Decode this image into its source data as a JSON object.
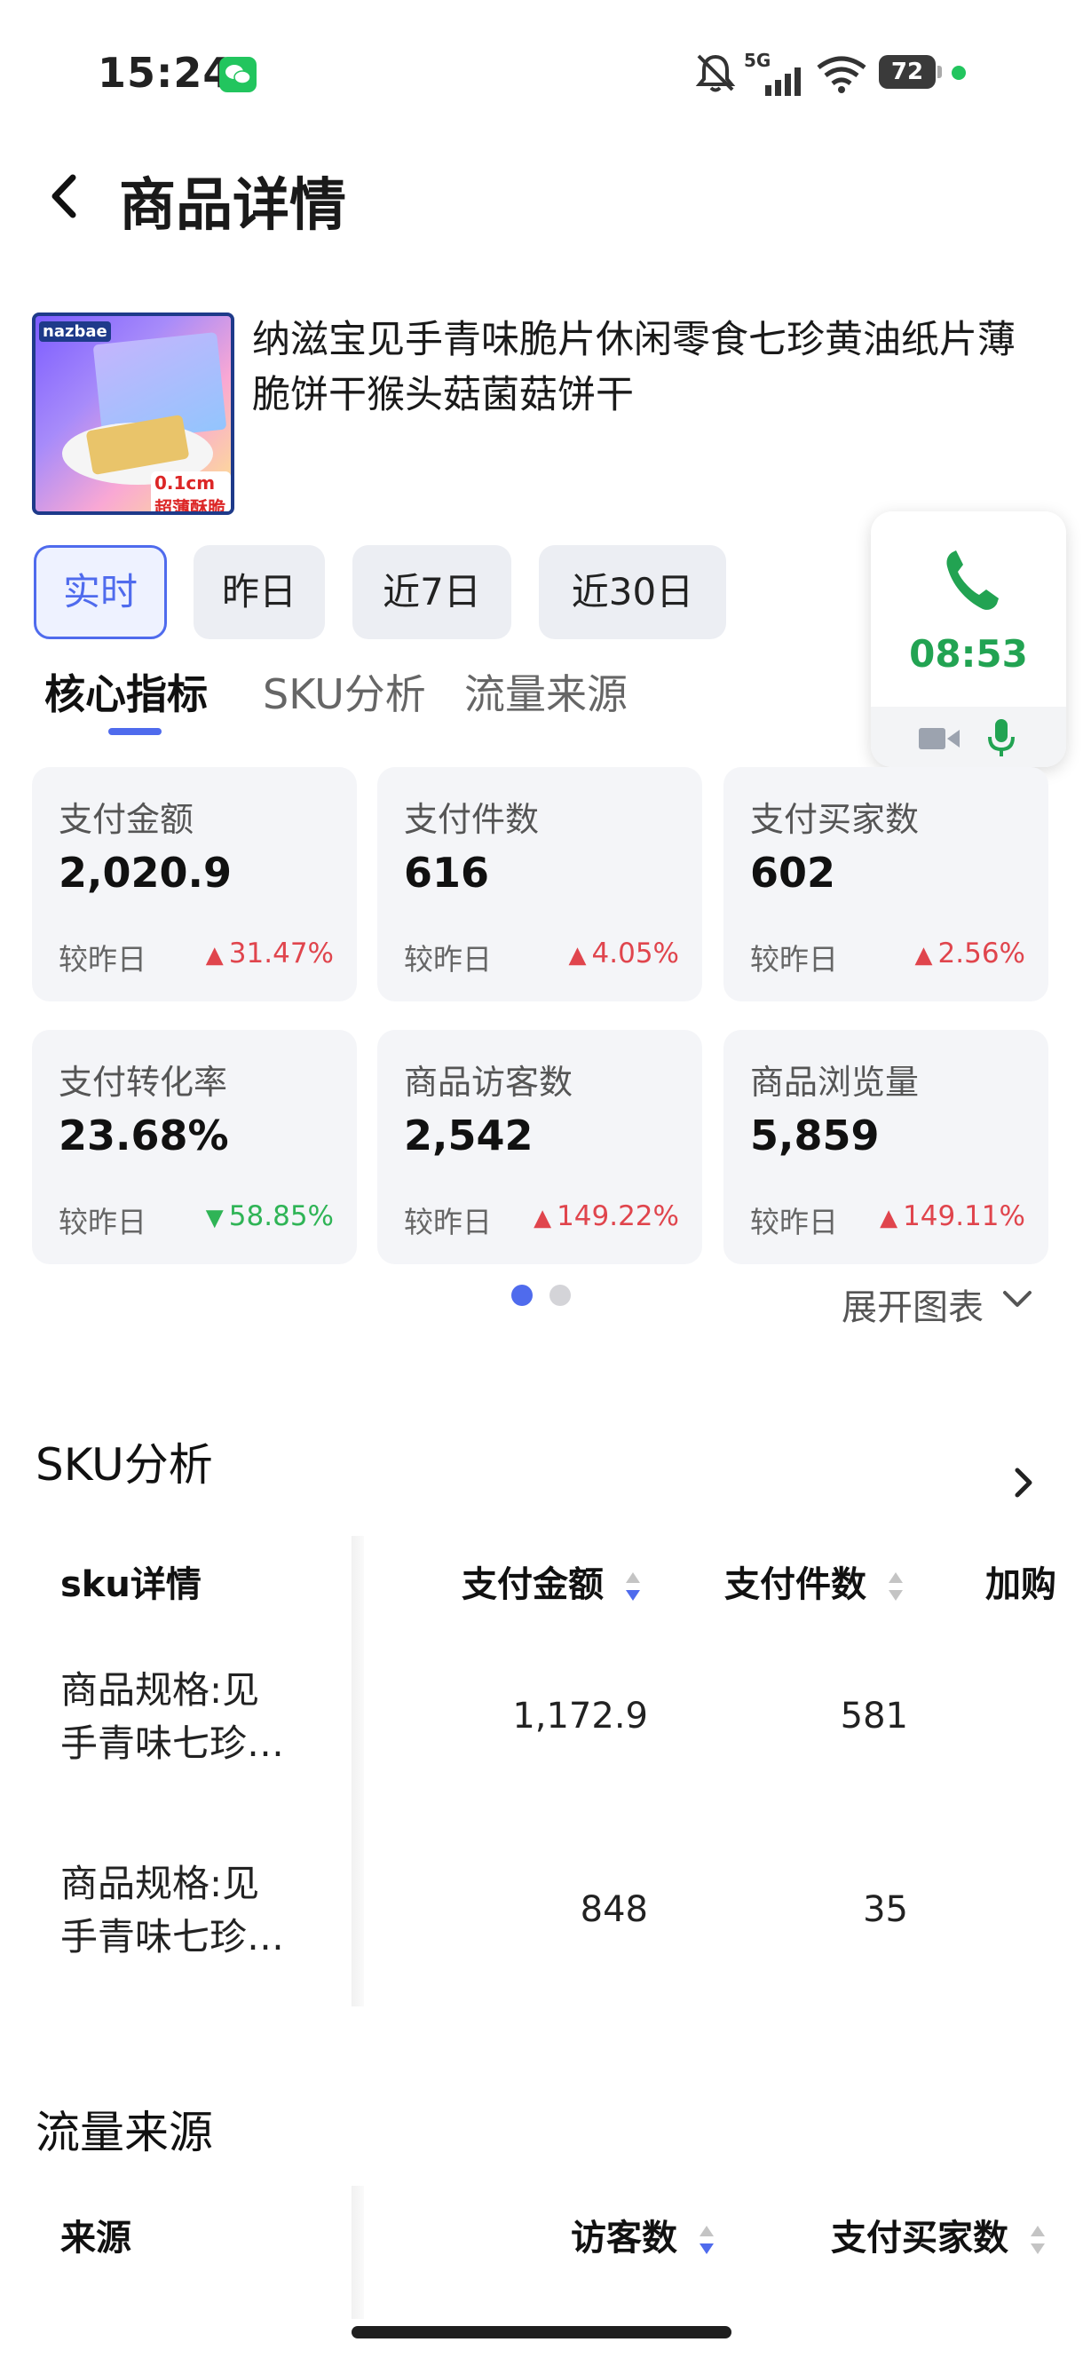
{
  "status_bar": {
    "time": "15:24",
    "network": "5G",
    "battery": "72"
  },
  "header": {
    "title": "商品详情"
  },
  "product": {
    "name": "纳滋宝见手青味脆片休闲零食七珍黄油纸片薄脆饼干猴头菇菌菇饼干",
    "image_brand": "nazbae",
    "image_tag": "0.1cm超薄酥脆"
  },
  "date_tabs": [
    "实时",
    "昨日",
    "近7日",
    "近30日"
  ],
  "call": {
    "duration": "08:53"
  },
  "section_tabs": [
    "核心指标",
    "SKU分析",
    "流量来源"
  ],
  "metrics": [
    {
      "label": "支付金额",
      "value": "2,020.9",
      "compare": "较昨日",
      "change": "31.47%",
      "direction": "up"
    },
    {
      "label": "支付件数",
      "value": "616",
      "compare": "较昨日",
      "change": "4.05%",
      "direction": "up"
    },
    {
      "label": "支付买家数",
      "value": "602",
      "compare": "较昨日",
      "change": "2.56%",
      "direction": "up"
    },
    {
      "label": "支付转化率",
      "value": "23.68%",
      "compare": "较昨日",
      "change": "58.85%",
      "direction": "down"
    },
    {
      "label": "商品访客数",
      "value": "2,542",
      "compare": "较昨日",
      "change": "149.22%",
      "direction": "up"
    },
    {
      "label": "商品浏览量",
      "value": "5,859",
      "compare": "较昨日",
      "change": "149.11%",
      "direction": "up"
    }
  ],
  "pagination": {
    "total": 2,
    "current": 1
  },
  "expand_chart": "展开图表",
  "sku": {
    "title": "SKU分析",
    "headers": [
      "sku详情",
      "支付金额",
      "支付件数",
      "加购"
    ],
    "rows": [
      {
        "spec_line1": "商品规格:见",
        "spec_line2": "手青味七珍…",
        "amount": "1,172.9",
        "count": "581"
      },
      {
        "spec_line1": "商品规格:见",
        "spec_line2": "手青味七珍…",
        "amount": "848",
        "count": "35"
      }
    ]
  },
  "traffic": {
    "title": "流量来源",
    "headers": [
      "来源",
      "访客数",
      "支付买家数"
    ]
  },
  "colors": {
    "accent": "#4f6bed",
    "up": "#e0454d",
    "down": "#2fb456",
    "call_green": "#22a352"
  }
}
